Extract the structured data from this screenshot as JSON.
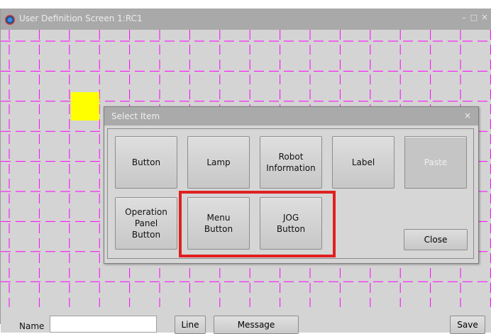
{
  "window": {
    "title": "User Definition Screen 1:RC1",
    "min_glyph": "–",
    "max_glyph": "□",
    "close_glyph": "×"
  },
  "dialog": {
    "title": "Select Item",
    "close_glyph": "×",
    "buttons": [
      {
        "label": "Button",
        "enabled": true
      },
      {
        "label": "Lamp",
        "enabled": true
      },
      {
        "label": "Robot\nInformation",
        "enabled": true
      },
      {
        "label": "Label",
        "enabled": true
      },
      {
        "label": "Paste",
        "enabled": false
      },
      {
        "label": "Operation\nPanel\nButton",
        "enabled": true
      },
      {
        "label": "Menu\nButton",
        "enabled": true
      },
      {
        "label": "JOG\nButton",
        "enabled": true
      }
    ],
    "close_label": "Close"
  },
  "bottom": {
    "name_label": "Name",
    "name_value": "",
    "line_label": "Line",
    "message_label": "Message",
    "save_label": "Save"
  },
  "colors": {
    "grid_line": "#ff00ff",
    "selected_cell": "#ffff00",
    "highlight_box": "#e02020"
  }
}
